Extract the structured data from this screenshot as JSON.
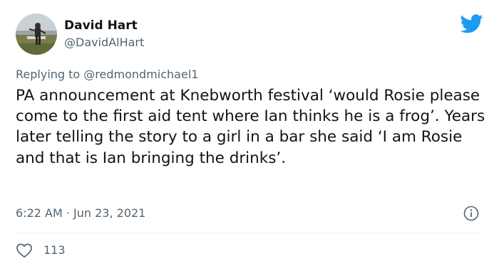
{
  "author": {
    "display_name": "David Hart",
    "handle": "@DavidAlHart",
    "avatar_icon": "profile-photo"
  },
  "reply": {
    "prefix": "Replying to",
    "mention": "@redmondmichael1"
  },
  "tweet": {
    "text": "PA announcement at Knebworth festival ‘would Rosie please come to the first aid tent where Ian thinks he is a frog’. Years later telling the story to a girl in a bar she said ‘I am Rosie and that is Ian bringing the drinks’.",
    "timestamp": "6:22 AM · Jun 23, 2021"
  },
  "engagement": {
    "like_count": "113"
  },
  "icons": {
    "brand": "twitter-bird-icon",
    "info": "info-icon",
    "like": "heart-icon"
  },
  "colors": {
    "twitter_blue": "#1d9bf0",
    "text_primary": "#0f1419",
    "text_secondary": "#536471",
    "divider": "#eff3f4"
  }
}
